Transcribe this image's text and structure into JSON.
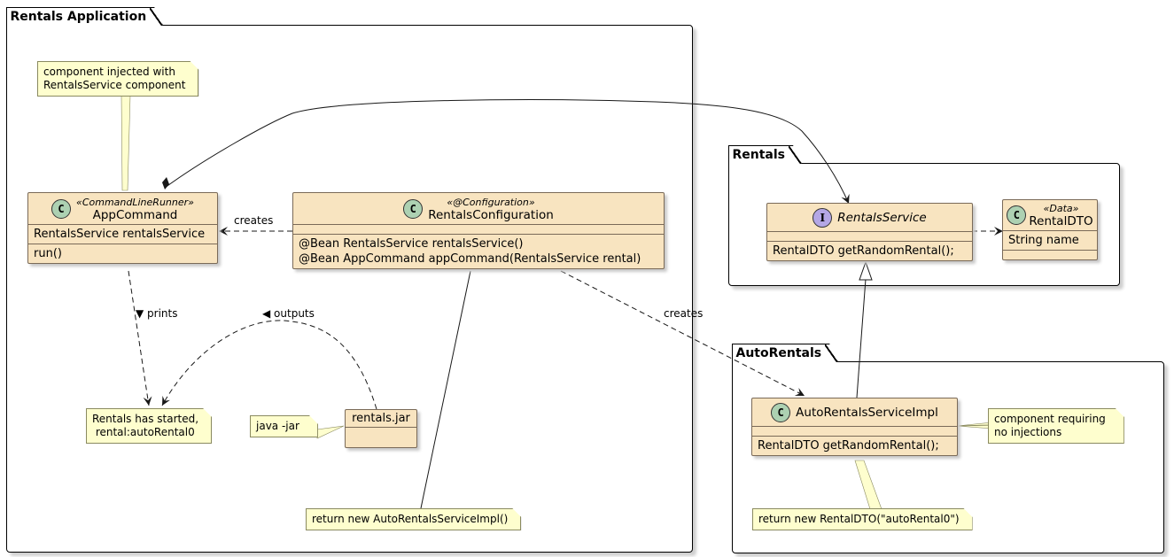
{
  "packages": {
    "rentals_application": {
      "label": "Rentals Application"
    },
    "rentals": {
      "label": "Rentals"
    },
    "auto_rentals": {
      "label": "AutoRentals"
    }
  },
  "classes": {
    "app_command": {
      "icon": "C",
      "stereotype": "«CommandLineRunner»",
      "name": "AppCommand",
      "fields": [
        "RentalsService rentalsService"
      ],
      "methods": [
        "run()"
      ]
    },
    "rentals_configuration": {
      "icon": "C",
      "stereotype": "«@Configuration»",
      "name": "RentalsConfiguration",
      "fields": [],
      "methods": [
        "@Bean RentalsService rentalsService()",
        "@Bean AppCommand appCommand(RentalsService rental)"
      ]
    },
    "rentals_service": {
      "icon": "I",
      "name": "RentalsService",
      "fields": [],
      "methods": [
        "RentalDTO getRandomRental();"
      ]
    },
    "rental_dto": {
      "icon": "C",
      "stereotype": "«Data»",
      "name": "RentalDTO",
      "fields": [
        "String name"
      ],
      "methods": []
    },
    "auto_rentals_service_impl": {
      "icon": "C",
      "name": "AutoRentalsServiceImpl",
      "fields": [],
      "methods": [
        "RentalDTO getRandomRental();"
      ]
    },
    "rentals_jar": {
      "name": "rentals.jar"
    }
  },
  "notes": {
    "component_injected": [
      "component injected with",
      "RentalsService component"
    ],
    "rentals_started": [
      "Rentals has started,",
      " rental:autoRental0"
    ],
    "java_jar": [
      "java -jar"
    ],
    "return_auto_impl": [
      "return new AutoRentalsServiceImpl()"
    ],
    "component_requiring": [
      "component requiring",
      "no injections"
    ],
    "return_rental_dto": [
      "return new RentalDTO(\"autoRental0\")"
    ]
  },
  "edge_labels": {
    "creates_app": "creates",
    "prints": "▼ prints",
    "outputs": "◀ outputs",
    "creates_impl": "creates"
  },
  "colors": {
    "class_fill": "#f8e4c0",
    "note_fill": "#fefece",
    "class_icon": "#add1b2",
    "interface_icon": "#b4a7e5"
  }
}
